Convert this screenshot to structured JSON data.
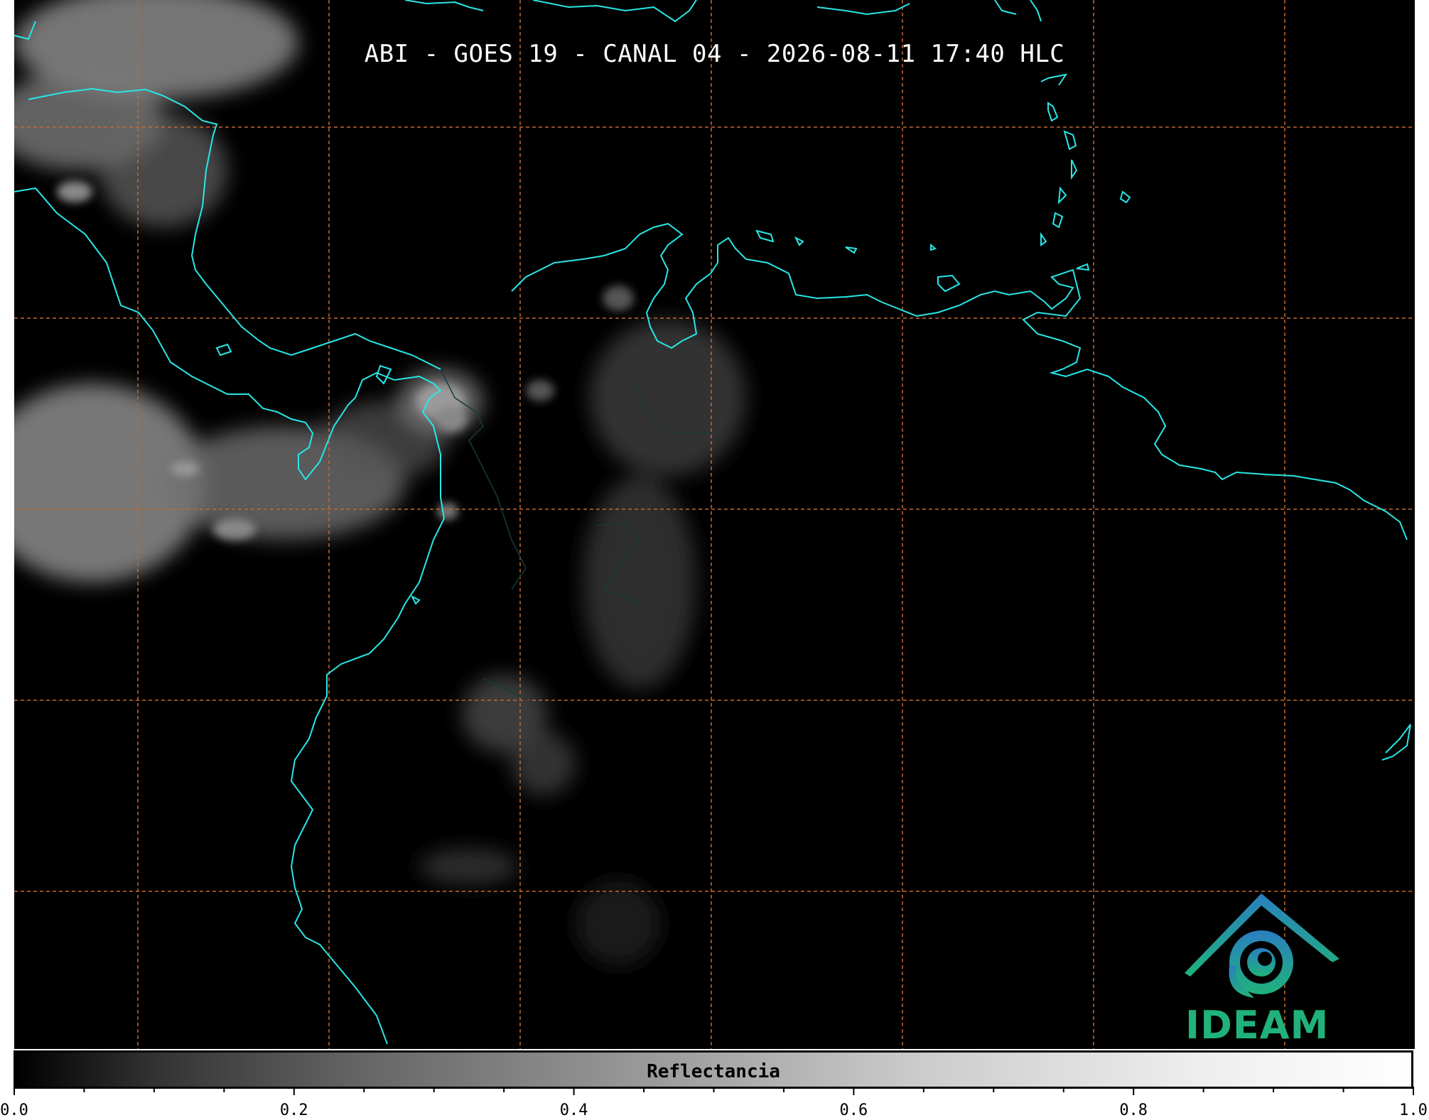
{
  "header": {
    "title": "ABI - GOES 19 - CANAL 04 - 2026-08-11 17:40 HLC"
  },
  "colorbar": {
    "label": "Reflectancia",
    "ticks": [
      "0.0",
      "0.2",
      "0.4",
      "0.6",
      "0.8",
      "1.0"
    ],
    "minor_ticks": 20,
    "min": 0.0,
    "max": 1.0
  },
  "logo": {
    "text": "IDEAM",
    "color": "#20b27a",
    "accent": "#2a7fc0"
  },
  "colors": {
    "coastline": "#29e6e6",
    "grid": "#c8682c",
    "background": "#000000",
    "clouds": "#bdbdbd"
  },
  "map": {
    "grid": true,
    "grid_style": "dashed"
  }
}
